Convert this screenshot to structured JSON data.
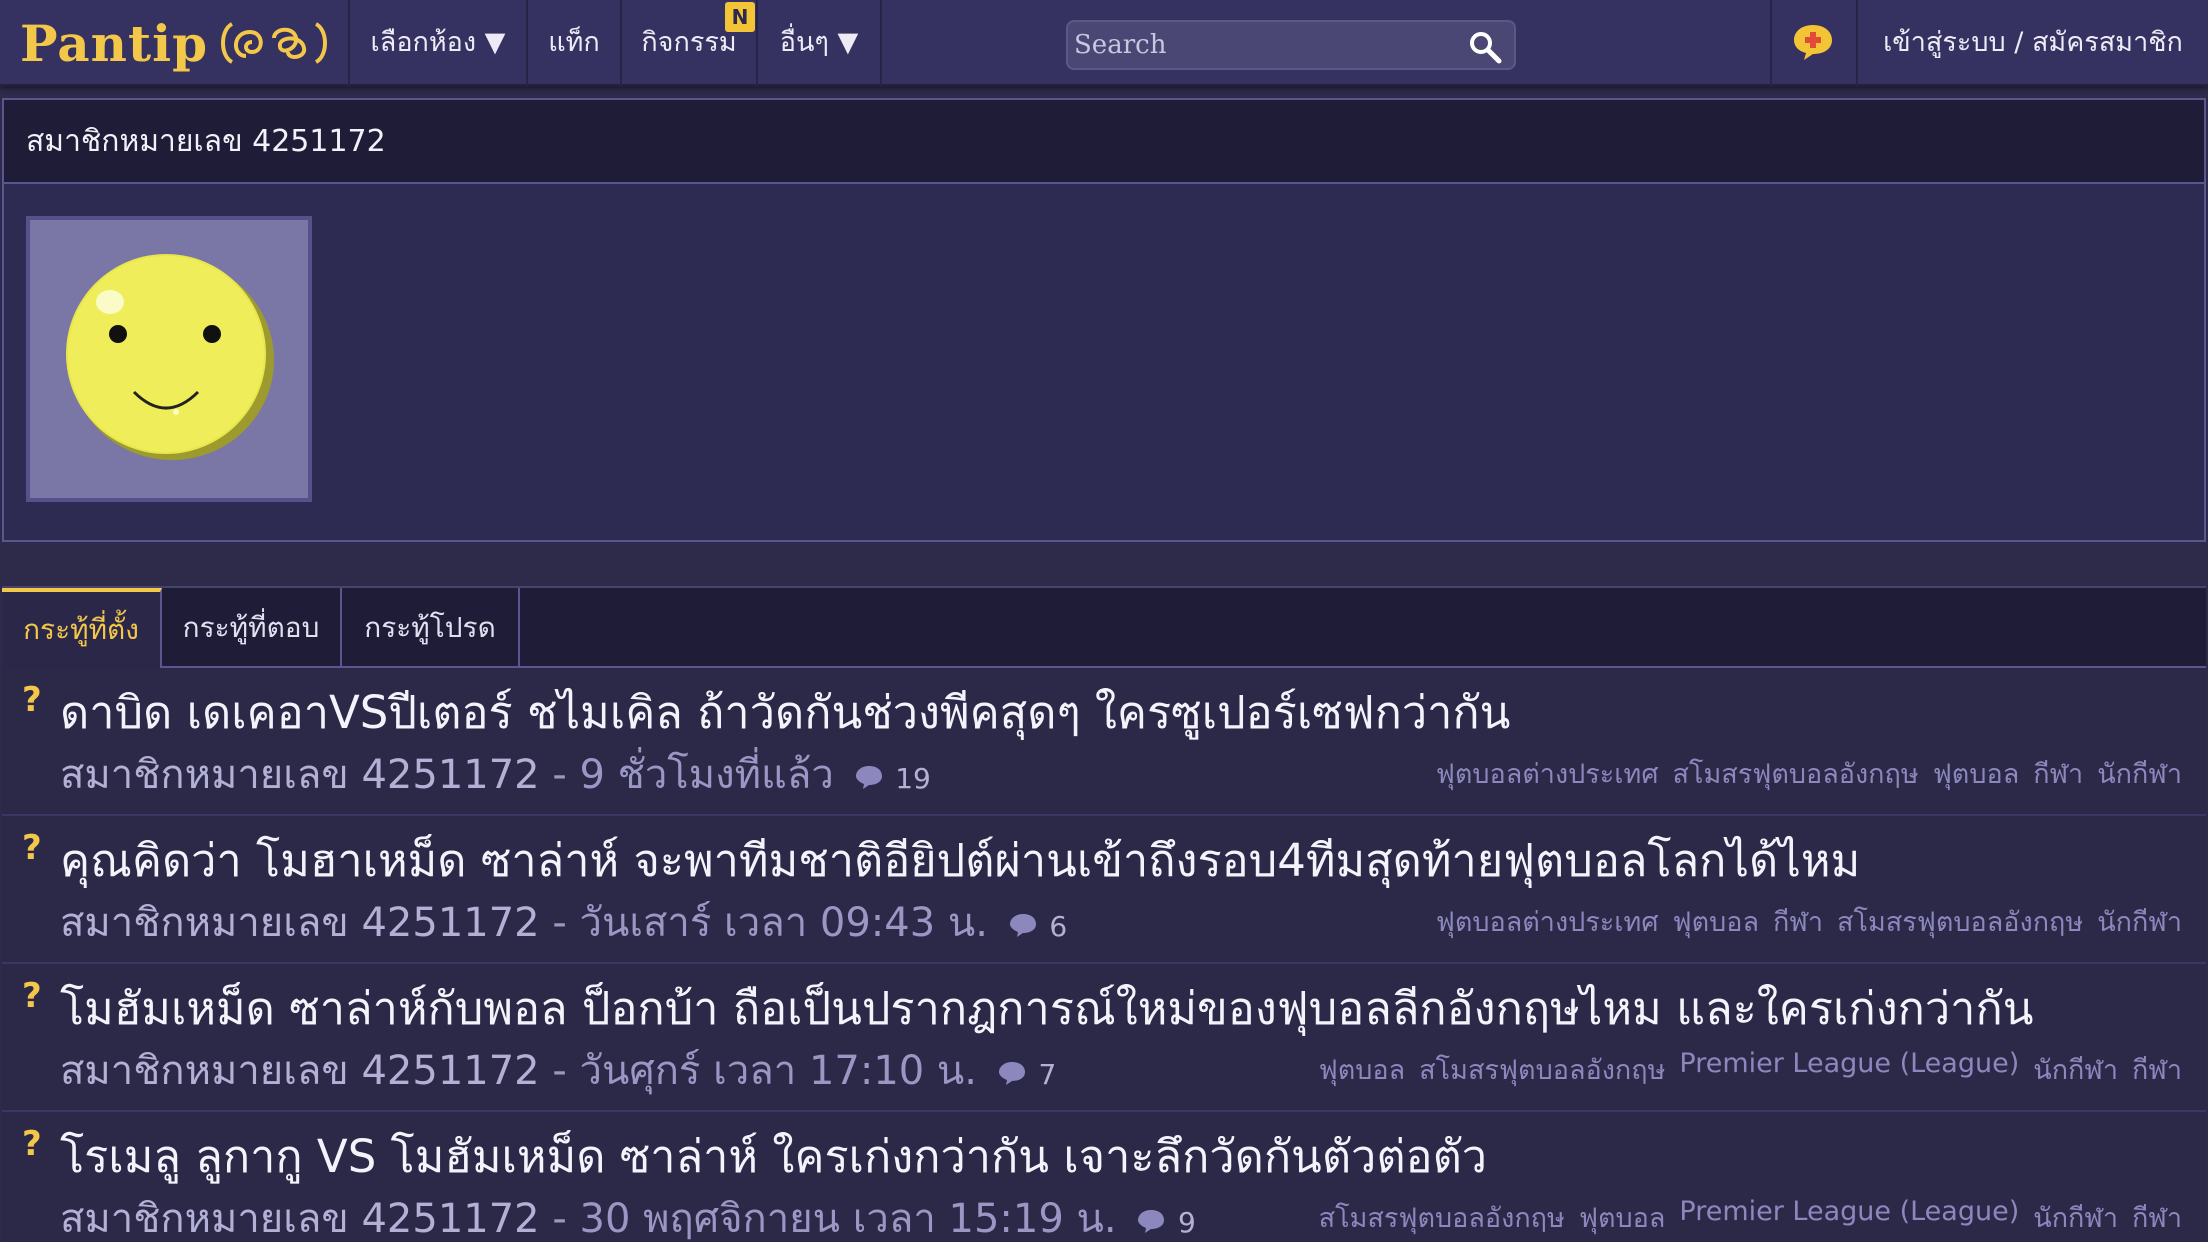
{
  "nav": {
    "logo_text": "Pantip",
    "items": [
      {
        "label": "เลือกห้อง ▼"
      },
      {
        "label": "แท็ก"
      },
      {
        "label": "กิจกรรม",
        "badge": "N"
      },
      {
        "label": "อื่นๆ ▼"
      }
    ],
    "search_placeholder": "Search",
    "login_label": "เข้าสู่ระบบ / สมัครสมาชิก"
  },
  "profile": {
    "name": "สมาชิกหมายเลข 4251172"
  },
  "tabs": [
    {
      "label": "กระทู้ที่ตั้ง",
      "active": true
    },
    {
      "label": "กระทู้ที่ตอบ",
      "active": false
    },
    {
      "label": "กระทู้โปรด",
      "active": false
    }
  ],
  "topics": [
    {
      "title": "ดาบิด เดเคอาVSปีเตอร์ ชไมเคิล ถ้าวัดกันช่วงพีคสุดๆ ใครซูเปอร์เซฟกว่ากัน",
      "author": "สมาชิกหมายเลข 4251172",
      "time": "- 9 ชั่วโมงที่แล้ว",
      "comments": "19",
      "tags": [
        "ฟุตบอลต่างประเทศ",
        "สโมสรฟุตบอลอังกฤษ",
        "ฟุตบอล",
        "กีฬา",
        "นักกีฬา"
      ]
    },
    {
      "title": "คุณคิดว่า โมฮาเหม็ด ซาล่าห์ จะพาทีมชาติอียิปต์ผ่านเข้าถึงรอบ4ทีมสุดท้ายฟุตบอลโลกได้ไหม",
      "author": "สมาชิกหมายเลข 4251172",
      "time": "- วันเสาร์ เวลา 09:43 น.",
      "comments": "6",
      "tags": [
        "ฟุตบอลต่างประเทศ",
        "ฟุตบอล",
        "กีฬา",
        "สโมสรฟุตบอลอังกฤษ",
        "นักกีฬา"
      ]
    },
    {
      "title": "โมฮัมเหม็ด ซาล่าห์กับพอล ป็อกบ้า ถือเป็นปรากฎการณ์ใหม่ของฟุบอลลีกอังกฤษไหม และใครเก่งกว่ากัน",
      "author": "สมาชิกหมายเลข 4251172",
      "time": "- วันศุกร์ เวลา 17:10 น.",
      "comments": "7",
      "tags": [
        "ฟุตบอล",
        "สโมสรฟุตบอลอังกฤษ",
        "Premier League (League)",
        "นักกีฬา",
        "กีฬา"
      ]
    },
    {
      "title": "โรเมลู ลูกากู VS โมฮัมเหม็ด ซาล่าห์ ใครเก่งกว่ากัน เจาะลึกวัดกันตัวต่อตัว",
      "author": "สมาชิกหมายเลข 4251172",
      "time": "- 30 พฤศจิกายน เวลา 15:19 น.",
      "comments": "9",
      "tags": [
        "สโมสรฟุตบอลอังกฤษ",
        "ฟุตบอล",
        "Premier League (League)",
        "นักกีฬา",
        "กีฬา"
      ]
    }
  ]
}
